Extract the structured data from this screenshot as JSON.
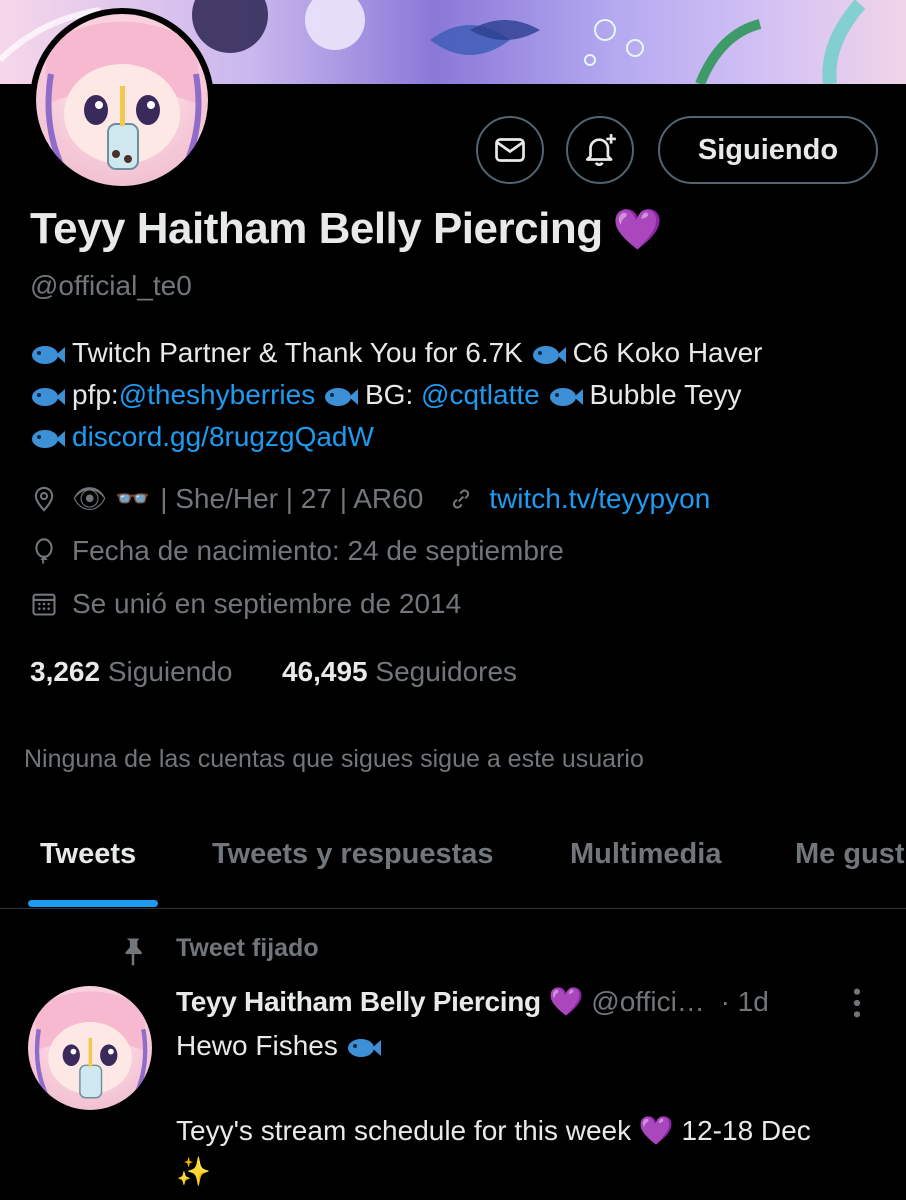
{
  "profile": {
    "name": "Teyy Haitham Belly Piercing",
    "name_emoji": "💜",
    "handle": "@official_te0",
    "follow_button": "Siguiendo"
  },
  "bio": {
    "line1_a": "Twitch Partner & Thank You for 6.7K",
    "line1_b": "C6 Koko Haver",
    "line2_a": "pfp:",
    "line2_link1": "@theshyberries",
    "line2_b": "BG:",
    "line2_link2": "@cqtlatte",
    "line2_c": "Bubble Teyy",
    "line3_link": "discord.gg/8rugzgQadW"
  },
  "meta": {
    "location_emojis": "👁 👓",
    "location_text": "| She/Her | 27 | AR60",
    "website": "twitch.tv/teyypyon",
    "birthday": "Fecha de nacimiento: 24 de septiembre",
    "joined": "Se unió en septiembre de 2014"
  },
  "counts": {
    "following_num": "3,262",
    "following_label": "Siguiendo",
    "followers_num": "46,495",
    "followers_label": "Seguidores"
  },
  "mutuals_note": "Ninguna de las cuentas que sigues sigue a este usuario",
  "tabs": [
    "Tweets",
    "Tweets y respuestas",
    "Multimedia",
    "Me gust"
  ],
  "pinned_tweet": {
    "label": "Tweet fijado",
    "author": "Teyy Haitham Belly Piercing",
    "author_emoji": "💜",
    "handle": "@offici…",
    "time": "· 1d",
    "line1": "Hewo Fishes",
    "line2_a": "Teyy's stream schedule for this week",
    "line2_emoji": "💜",
    "line2_b": "12-18 Dec",
    "line3": "✨"
  },
  "icons": [
    "mail-icon",
    "bell-plus-icon",
    "location-icon",
    "link-icon",
    "balloon-icon",
    "calendar-icon",
    "pin-icon",
    "more-icon",
    "fish-emoji"
  ],
  "colors": {
    "background": "#000000",
    "text": "#e7e9ea",
    "muted": "#71767b",
    "link": "#1d9bf0",
    "heart": "#ac97e6",
    "border": "#536471"
  }
}
